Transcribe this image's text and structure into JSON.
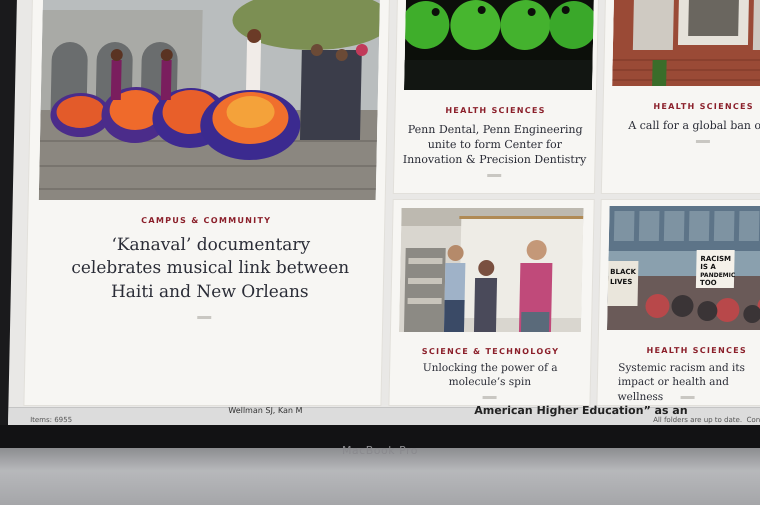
{
  "articles": [
    {
      "category": "CAMPUS & COMMUNITY",
      "title": "‘Kanaval’ documentary celebrates musical link between Haiti and New Orleans"
    },
    {
      "category": "HEALTH SCIENCES",
      "title": "Penn Dental, Penn Engineering unite to form Center for Innovation & Precision Dentistry"
    },
    {
      "category": "HEALTH SCIENCES",
      "title": "A call for a global ban on lead p"
    },
    {
      "category": "SCIENCE & TECHNOLOGY",
      "title": "Unlocking the power of a molecule’s spin"
    },
    {
      "category": "HEALTH SCIENCES",
      "title": "Systemic racism and its impact or health and wellness"
    }
  ],
  "protest_signs": [
    "RACISM",
    "IS A",
    "PANDEMIC",
    "TOO",
    "BLACK",
    "LIVES"
  ],
  "statusbar": {
    "items": "Items: 6955",
    "folders": "All folders are up to date.",
    "extra": "Conn",
    "peek_author": "Wellman SJ, Kan M",
    "peek_title": "American Higher Education” as an"
  },
  "device": {
    "brand": "MacBook Pro"
  },
  "colors": {
    "category": "#8b1f2a",
    "title": "#2a2c36",
    "card": "#f7f6f3"
  }
}
